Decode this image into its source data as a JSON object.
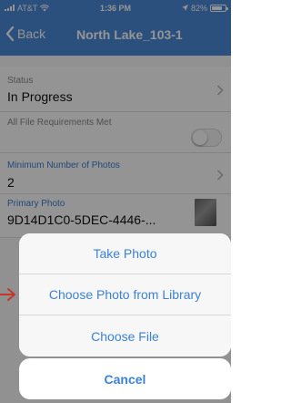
{
  "status_bar": {
    "carrier": "AT&T",
    "time": "1:36 PM",
    "battery": "82%",
    "battery_level": 0.82
  },
  "nav": {
    "back_label": "Back",
    "title": "North Lake_103-1"
  },
  "form": {
    "status": {
      "label": "Status",
      "value": "In Progress"
    },
    "file_requirements": {
      "label": "All File Requirements Met",
      "enabled": false
    },
    "min_photos": {
      "label": "Minimum Number of Photos",
      "value": "2"
    },
    "primary_photo": {
      "label": "Primary Photo",
      "value": "9D14D1C0-5DEC-4446-..."
    }
  },
  "action_sheet": {
    "items": [
      {
        "label": "Take Photo"
      },
      {
        "label": "Choose Photo from Library"
      },
      {
        "label": "Choose File"
      }
    ],
    "cancel_label": "Cancel"
  },
  "colors": {
    "nav_background": "#4a8bd9",
    "action_text": "#3b82d6",
    "field_label_blue": "#3b7cd0",
    "pointer_arrow": "#c0392b"
  }
}
